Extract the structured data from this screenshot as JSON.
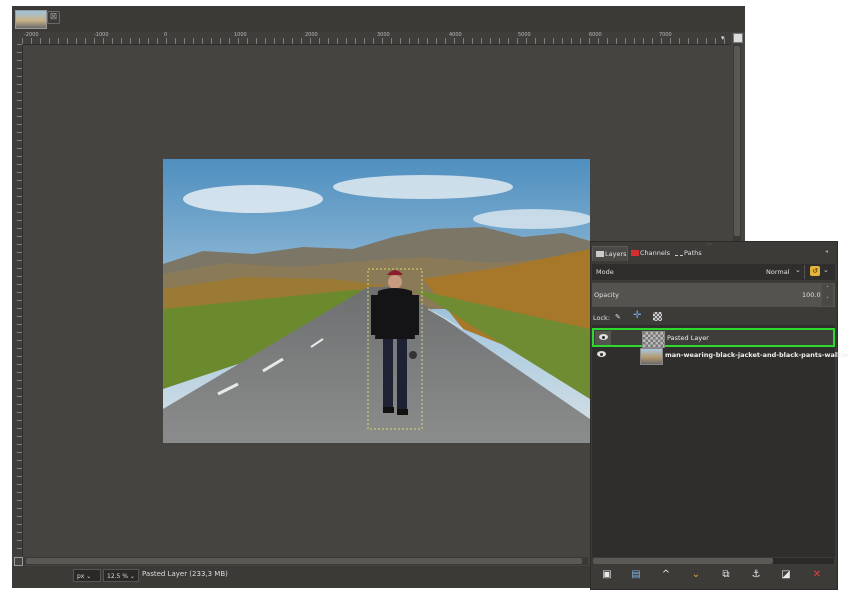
{
  "window": {
    "tab_close": "⊠"
  },
  "ruler": {
    "labels": [
      "-2000",
      "-1000",
      "0",
      "1000",
      "2000",
      "3000",
      "4000",
      "5000",
      "6000",
      "7000"
    ],
    "menu_arrow": "▾"
  },
  "statusbar": {
    "unit": "px",
    "zoom": "12.5 %",
    "text": "Pasted Layer (233,3 MB)"
  },
  "dock": {
    "tabs": {
      "layers": "Layers",
      "channels": "Channels",
      "paths": "Paths"
    },
    "menu": "◂",
    "mode_label": "Mode",
    "mode_value": "Normal",
    "opacity_label": "Opacity",
    "opacity_value": "100.0",
    "lock_label": "Lock:",
    "layers": [
      {
        "name": "Pasted Layer",
        "visible": true,
        "selected": true
      },
      {
        "name": "man-wearing-black-jacket-and-black-pants-walkin",
        "visible": true,
        "selected": false
      }
    ],
    "selection_color": "#2fd82f"
  },
  "icons": {
    "new_layer": "page-icon",
    "new_group": "folder-icon",
    "raise": "chevron-up-icon",
    "lower": "chevron-down-icon",
    "duplicate": "duplicate-icon",
    "anchor": "anchor-icon",
    "mask": "mask-icon",
    "delete": "delete-icon"
  }
}
